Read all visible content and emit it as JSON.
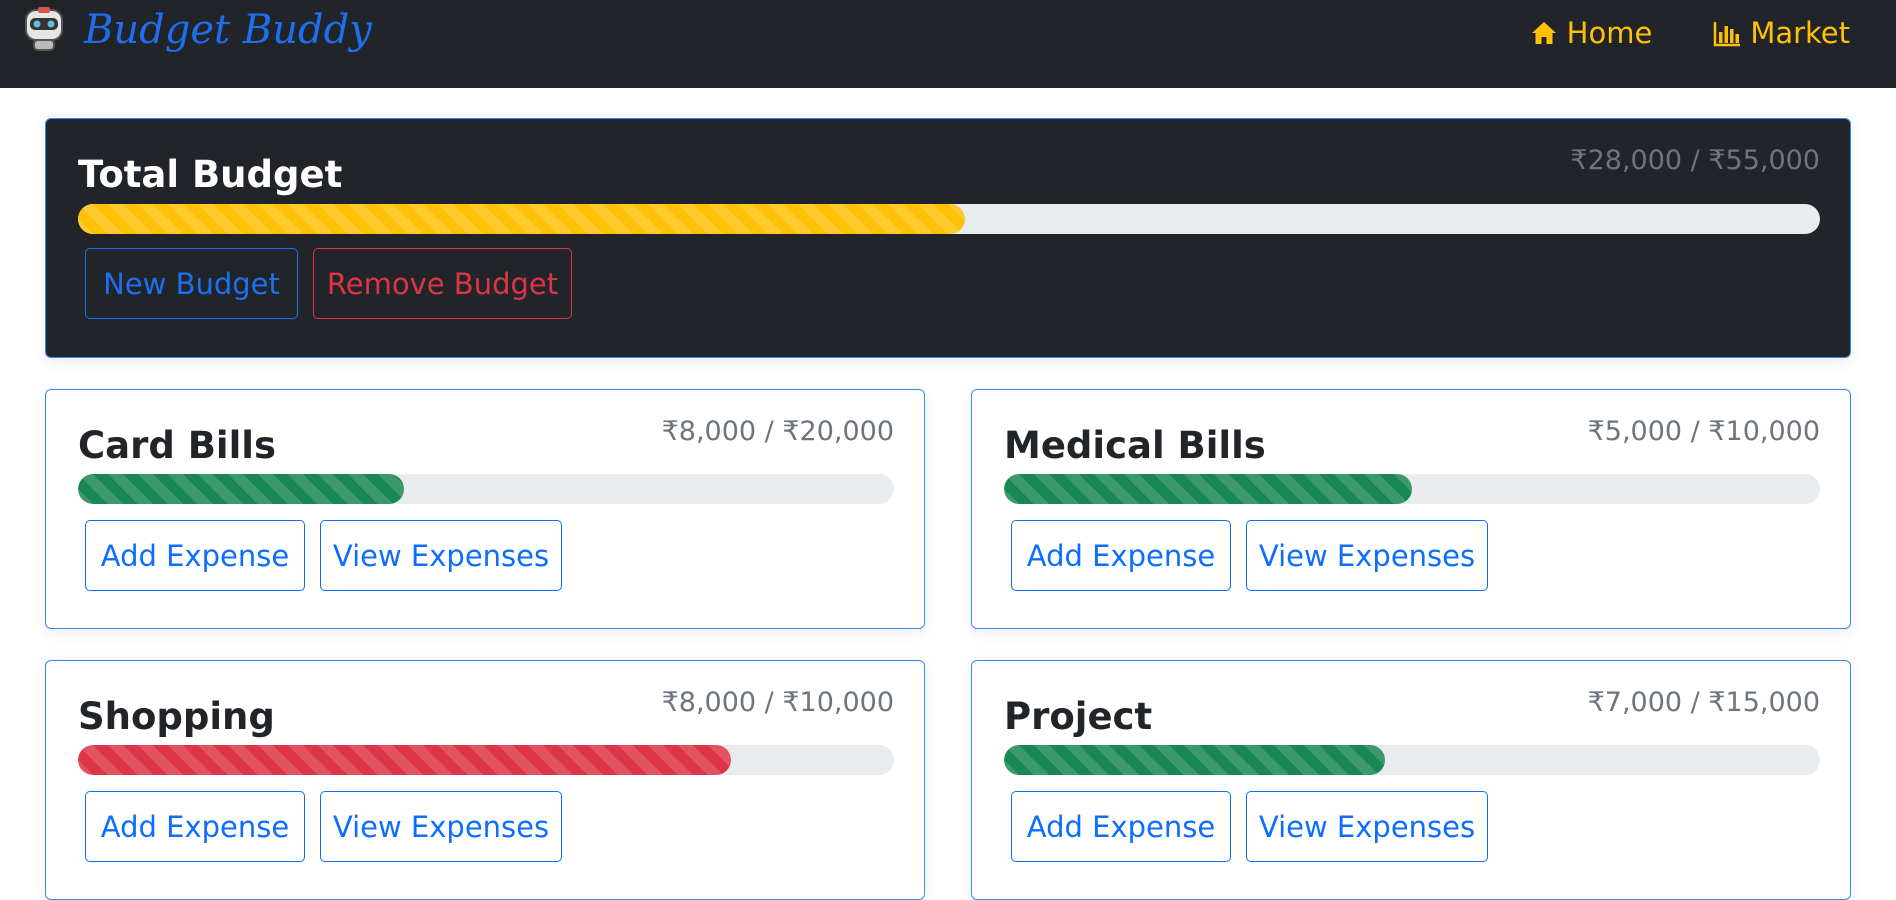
{
  "app": {
    "brand": "Budget Buddy",
    "nav": [
      {
        "label": "Home",
        "icon": "home-icon"
      },
      {
        "label": "Market",
        "icon": "bar-chart-icon"
      }
    ]
  },
  "total": {
    "title": "Total Budget",
    "amount": "₹28,000 / ₹55,000",
    "progress": 0.509,
    "color": "#ffc107",
    "new_budget": "New Budget",
    "remove_budget": "Remove Budget"
  },
  "budgets": [
    {
      "title": "Card Bills",
      "amount": "₹8,000 / ₹20,000",
      "progress": 0.4,
      "color": "#198754",
      "add": "Add Expense",
      "view": "View Expenses"
    },
    {
      "title": "Medical Bills",
      "amount": "₹5,000 / ₹10,000",
      "progress": 0.5,
      "color": "#198754",
      "add": "Add Expense",
      "view": "View Expenses"
    },
    {
      "title": "Shopping",
      "amount": "₹8,000 / ₹10,000",
      "progress": 0.8,
      "color": "#dc3545",
      "add": "Add Expense",
      "view": "View Expenses"
    },
    {
      "title": "Project",
      "amount": "₹7,000 / ₹15,000",
      "progress": 0.467,
      "color": "#198754",
      "add": "Add Expense",
      "view": "View Expenses"
    }
  ],
  "colors": {
    "navbar": "#212529",
    "accent": "#ffc107",
    "primary": "#0d6efd",
    "danger": "#dc3545",
    "success": "#198754"
  }
}
